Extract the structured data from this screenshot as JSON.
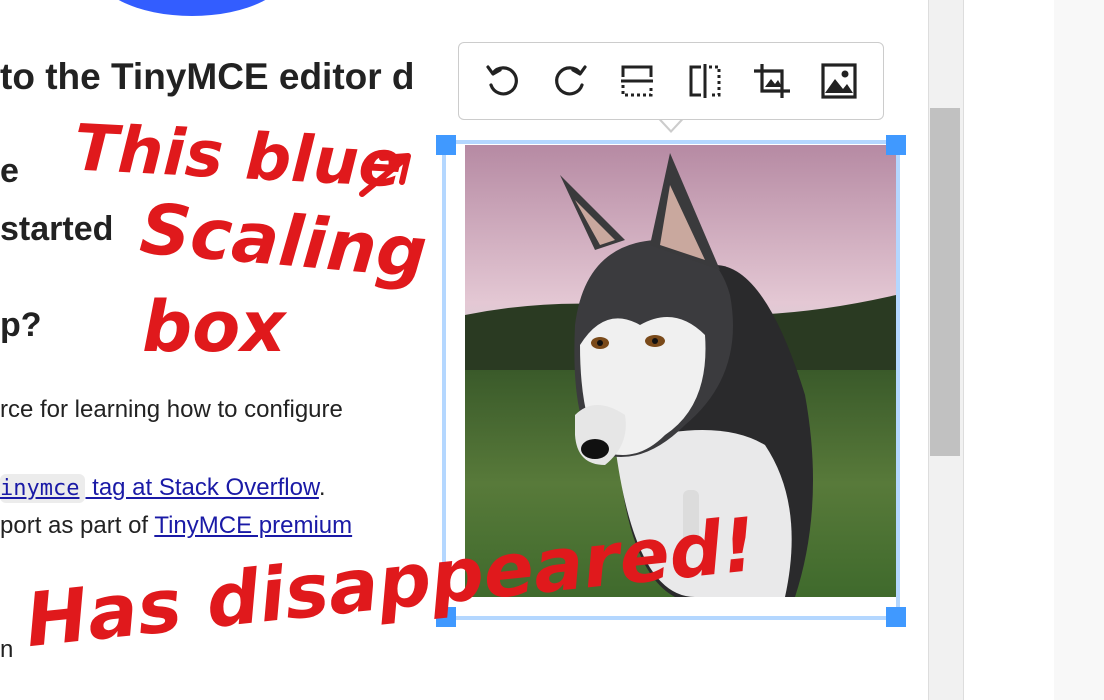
{
  "document": {
    "heading": "to the TinyMCE editor d",
    "line_e": "e",
    "line_started": "started",
    "line_p": "p?",
    "para1": "rce for learning how to configure",
    "para2_code": "inymce",
    "para2_link": " tag at Stack Overflow",
    "para2_end": ".",
    "para3_prefix": "port as part of ",
    "para3_link": "TinyMCE premium",
    "para4": "n"
  },
  "image": {
    "alt": "Husky dog photo",
    "colors": {
      "selection_border": "#b4d7ff",
      "handle": "#4099ff"
    }
  },
  "toolbar": {
    "buttons": [
      {
        "name": "rotate-left",
        "icon": "rotate-left-icon"
      },
      {
        "name": "rotate-right",
        "icon": "rotate-right-icon"
      },
      {
        "name": "flip-vertical",
        "icon": "flip-vertical-icon"
      },
      {
        "name": "flip-horizontal",
        "icon": "flip-horizontal-icon"
      },
      {
        "name": "crop",
        "icon": "crop-icon"
      },
      {
        "name": "image-options",
        "icon": "image-icon"
      }
    ]
  },
  "annotations": {
    "line1": "This blue",
    "line2": "Scaling",
    "line3": "box",
    "line4": "Has disappeared!",
    "color": "#e0191c"
  }
}
